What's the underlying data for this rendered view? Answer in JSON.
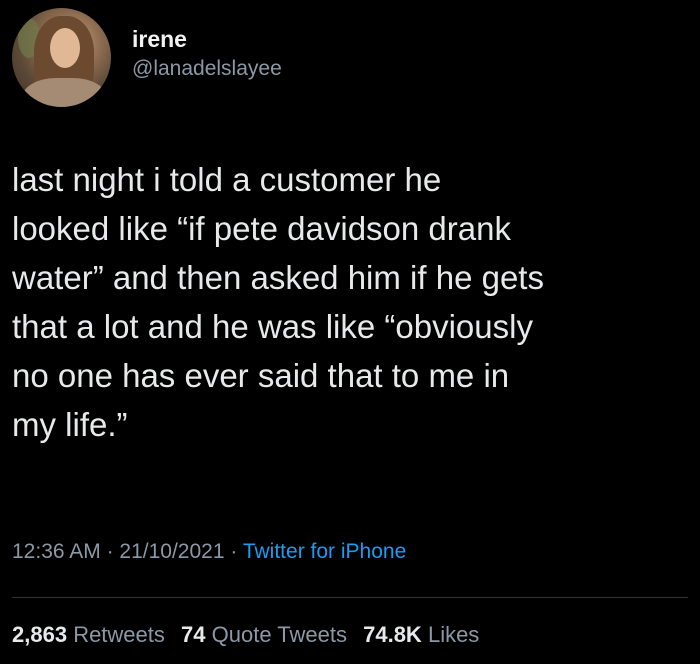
{
  "tweet": {
    "author": {
      "display_name": "irene",
      "handle": "@lanadelslayee"
    },
    "text_lines": [
      "last night i told a customer he",
      "looked like “if pete davidson drank",
      "water” and then asked him if he gets",
      "that a lot and he was like “obviously",
      "no one has ever said that to me in",
      "my life.”"
    ],
    "meta": {
      "time": "12:36 AM",
      "separator": "·",
      "date": "21/10/2021",
      "source": "Twitter for iPhone"
    },
    "stats": {
      "retweets_count": "2,863",
      "retweets_label": "Retweets",
      "quotes_count": "74",
      "quotes_label": "Quote Tweets",
      "likes_count": "74.8K",
      "likes_label": "Likes"
    }
  },
  "colors": {
    "background": "#000000",
    "text": "#e7e9ea",
    "secondary": "#8b98a5",
    "link": "#1d9bf0"
  }
}
